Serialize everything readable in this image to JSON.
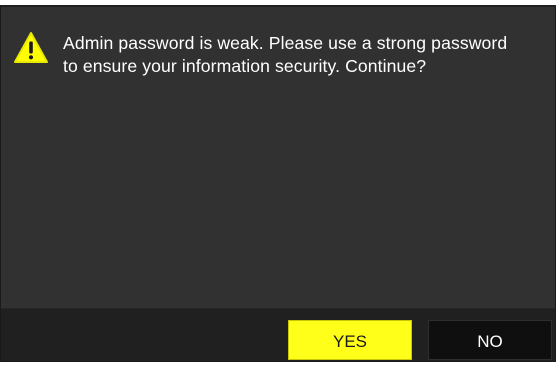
{
  "dialog": {
    "message_line1": "Admin password is weak. Please use a strong password",
    "message_line2": "to ensure your information security. Continue?",
    "icon": "warning-icon"
  },
  "buttons": {
    "yes_label": "YES",
    "no_label": "NO"
  },
  "colors": {
    "dialog_background": "#313131",
    "footer_background": "#202020",
    "yes_button": "#ffff1a",
    "no_button": "#0f0f0f",
    "warning_icon": "#ffff00"
  }
}
